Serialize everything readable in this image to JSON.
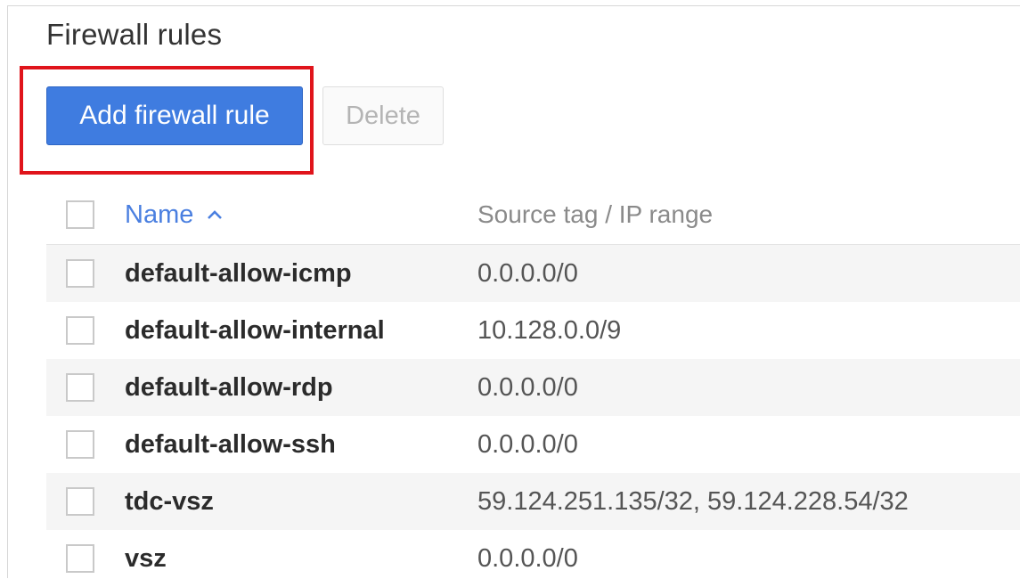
{
  "page": {
    "title": "Firewall rules"
  },
  "toolbar": {
    "add_label": "Add firewall rule",
    "delete_label": "Delete"
  },
  "table": {
    "columns": {
      "name": "Name",
      "source": "Source tag / IP range"
    },
    "sort": {
      "column": "name",
      "direction": "ascending",
      "icon": "chevron-up-icon"
    },
    "rows": [
      {
        "name": "default-allow-icmp",
        "source": "0.0.0.0/0",
        "checked": false
      },
      {
        "name": "default-allow-internal",
        "source": "10.128.0.0/9",
        "checked": false
      },
      {
        "name": "default-allow-rdp",
        "source": "0.0.0.0/0",
        "checked": false
      },
      {
        "name": "default-allow-ssh",
        "source": "0.0.0.0/0",
        "checked": false
      },
      {
        "name": "tdc-vsz",
        "source": "59.124.251.135/32, 59.124.228.54/32",
        "checked": false
      },
      {
        "name": "vsz",
        "source": "0.0.0.0/0",
        "checked": false
      }
    ]
  },
  "colors": {
    "primary_button": "#3f7ce0",
    "highlight_outline": "#e0141b",
    "header_link": "#4a7fe0",
    "stripe": "#f5f5f5"
  }
}
